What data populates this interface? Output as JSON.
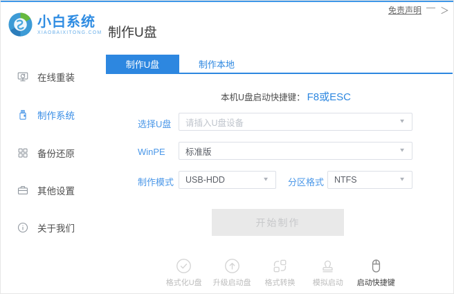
{
  "window": {
    "disclaimer_label": "免责声明",
    "minimize_glyph": "—",
    "chevron_glyph": "＞"
  },
  "brand": {
    "name": "小白系统",
    "domain": "XIAOBAIXITONG.COM",
    "logo_icon": "swirl-globe-icon"
  },
  "page": {
    "title": "制作U盘"
  },
  "sidebar": {
    "items": [
      {
        "label": "在线重装",
        "icon": "monitor-reinstall-icon",
        "active": false
      },
      {
        "label": "制作系统",
        "icon": "usb-drive-icon",
        "active": true
      },
      {
        "label": "备份还原",
        "icon": "grid-squares-icon",
        "active": false
      },
      {
        "label": "其他设置",
        "icon": "briefcase-icon",
        "active": false
      },
      {
        "label": "关于我们",
        "icon": "info-circle-icon",
        "active": false
      }
    ]
  },
  "tabs": [
    {
      "label": "制作U盘",
      "active": true
    },
    {
      "label": "制作本地",
      "active": false
    }
  ],
  "hotkey": {
    "label": "本机U盘启动快捷键：",
    "value": "F8或ESC"
  },
  "form": {
    "usb": {
      "label": "选择U盘",
      "placeholder": "请插入U盘设备"
    },
    "winpe": {
      "label": "WinPE",
      "value": "标准版"
    },
    "mode": {
      "label": "制作模式",
      "value": "USB-HDD"
    },
    "partition": {
      "label": "分区格式",
      "value": "NTFS"
    },
    "caret_glyph": "▼"
  },
  "start_button": {
    "label": "开始制作",
    "enabled": false
  },
  "actions": [
    {
      "label": "格式化U盘",
      "icon": "check-circle-icon",
      "active": false
    },
    {
      "label": "升级启动盘",
      "icon": "arrow-up-circle-icon",
      "active": false
    },
    {
      "label": "格式转换",
      "icon": "format-convert-icon",
      "active": false
    },
    {
      "label": "模拟启动",
      "icon": "stamp-icon",
      "active": false
    },
    {
      "label": "启动快捷键",
      "icon": "mouse-icon",
      "active": true
    }
  ],
  "colors": {
    "primary_blue": "#2d87e0",
    "label_blue": "#4a97e8",
    "top_accent": "#3e97e8",
    "disabled_button_bg": "#e9e9e9",
    "disabled_button_text": "#c7c8ca",
    "muted_icon": "#d4d4d4",
    "muted_label": "#bcbcbc"
  }
}
